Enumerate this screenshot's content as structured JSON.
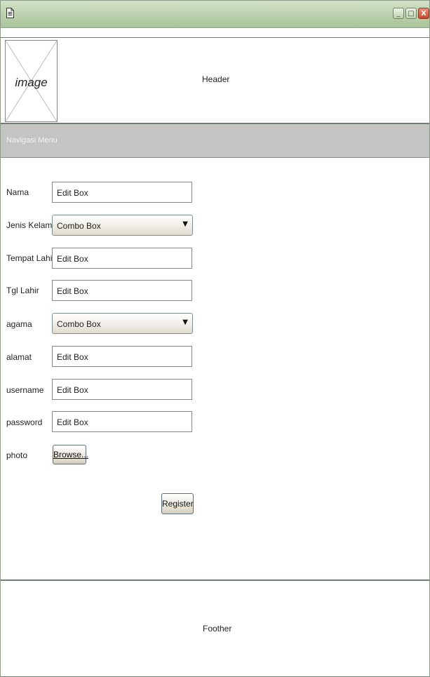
{
  "window": {
    "minimize_label": "_",
    "maximize_label": "□",
    "close_label": "X"
  },
  "header": {
    "image_placeholder": "image",
    "title": "Header"
  },
  "nav": {
    "label": "Navigasi Menu"
  },
  "form": {
    "nama": {
      "label": "Nama",
      "value": "Edit Box"
    },
    "jenis_kelamin": {
      "label": "Jenis Kelamin",
      "value": "Combo Box",
      "arrow": "▼"
    },
    "tempat_lahir": {
      "label": "Tempat Lahir",
      "value": "Edit Box"
    },
    "tgl_lahir": {
      "label": "Tgl Lahir",
      "value": "Edit Box"
    },
    "agama": {
      "label": "agama",
      "value": "Combo Box",
      "arrow": "▼"
    },
    "alamat": {
      "label": "alamat",
      "value": "Edit Box"
    },
    "username": {
      "label": "username",
      "value": "Edit Box"
    },
    "password": {
      "label": "password",
      "value": "Edit Box"
    },
    "photo": {
      "label": "photo",
      "browse_label": "Browse..."
    },
    "register_label": "Register"
  },
  "footer": {
    "text": "Foother"
  },
  "colors": {
    "title_bar": "#b9cfaa",
    "nav_bar": "#c4c4c4",
    "close_button": "#c64a2a"
  },
  "icons": [
    "document-icon",
    "minimize-icon",
    "maximize-icon",
    "close-icon",
    "dropdown-arrow-icon"
  ]
}
